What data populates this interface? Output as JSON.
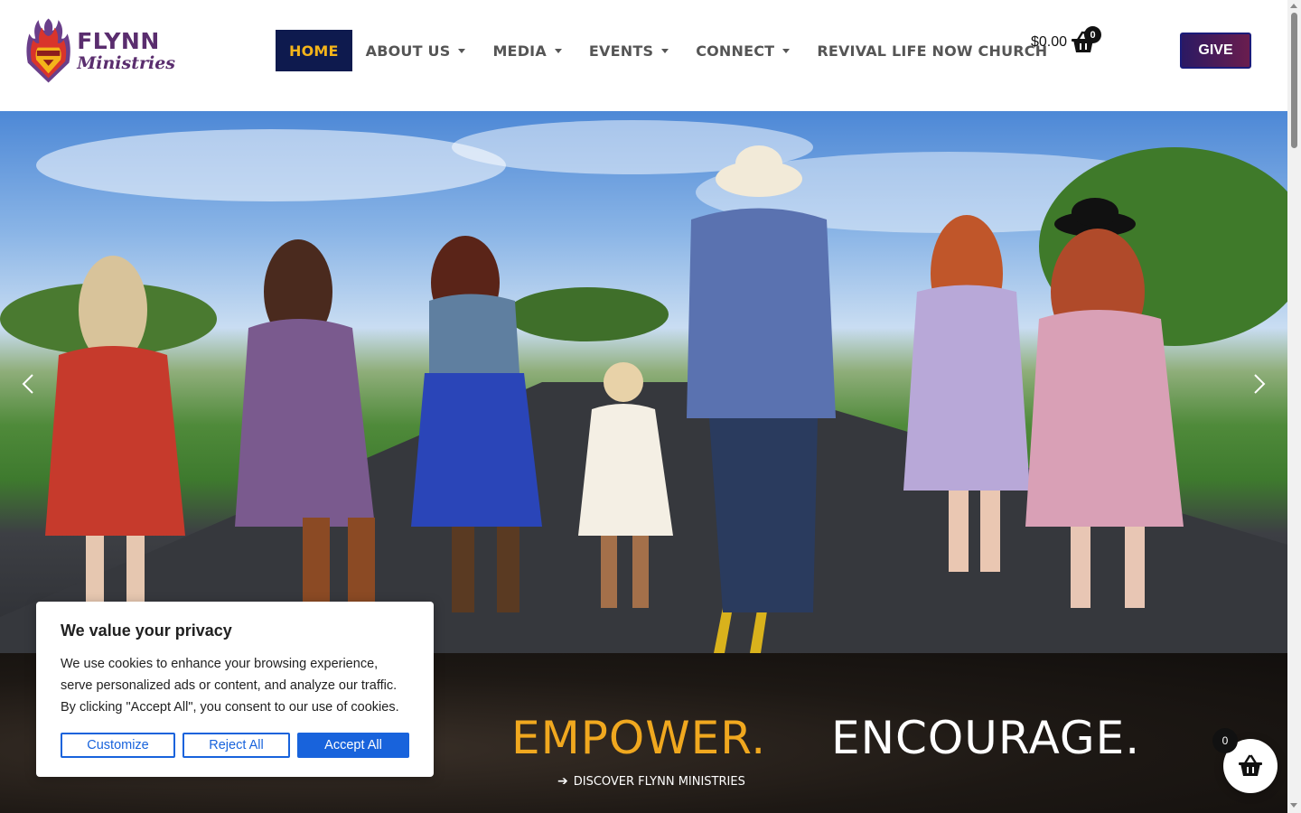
{
  "brand": {
    "name_line1": "FLYNN",
    "name_line2": "Ministries",
    "primary_color": "#5a2d6e",
    "accent_color": "#f4b41a"
  },
  "nav": {
    "items": [
      {
        "label": "HOME",
        "active": true,
        "dropdown": false
      },
      {
        "label": "ABOUT US",
        "active": false,
        "dropdown": true
      },
      {
        "label": "MEDIA",
        "active": false,
        "dropdown": true
      },
      {
        "label": "EVENTS",
        "active": false,
        "dropdown": true
      },
      {
        "label": "CONNECT",
        "active": false,
        "dropdown": true
      },
      {
        "label": "REVIVAL LIFE NOW CHURCH",
        "active": false,
        "dropdown": false
      }
    ]
  },
  "cart": {
    "amount": "$0.00",
    "count": "0",
    "icon": "basket-icon"
  },
  "give_button": {
    "label": "GIVE"
  },
  "hero": {
    "prev_icon": "chevron-left-icon",
    "next_icon": "chevron-right-icon"
  },
  "banner": {
    "word1": "EMPOWER.",
    "word2": "ENCOURAGE.",
    "link_label": "DISCOVER FLYNN MINISTRIES",
    "link_icon": "arrow-right-icon"
  },
  "cookie_notice": {
    "title": "We value your privacy",
    "text": "We use cookies to enhance your browsing experience, serve personalized ads or content, and analyze our traffic. By clicking \"Accept All\", you consent to our use of cookies.",
    "customize_label": "Customize",
    "reject_label": "Reject All",
    "accept_label": "Accept All",
    "button_color": "#1863dc"
  },
  "floating_cart": {
    "count": "0",
    "icon": "basket-icon"
  }
}
